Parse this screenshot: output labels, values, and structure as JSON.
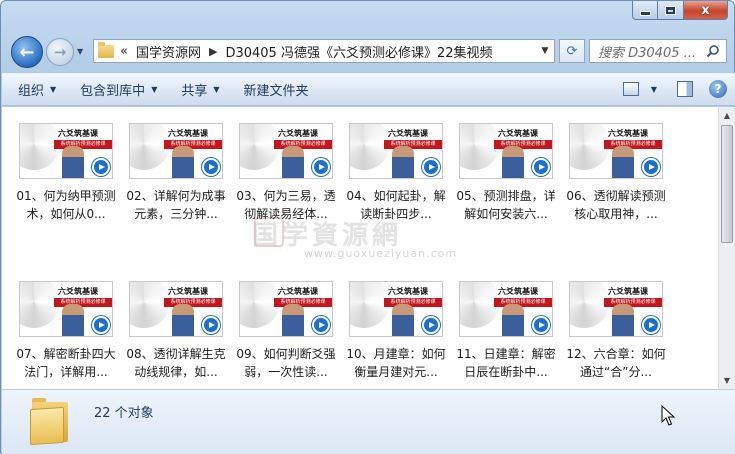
{
  "window": {
    "address_crumbs": [
      "«",
      "国学资源网",
      "D30405 冯德强《六爻预测必修课》22集视频"
    ],
    "search_placeholder": "搜索 D30405 ...",
    "caption_close": "x"
  },
  "toolbar": {
    "items": [
      {
        "label": "组织",
        "has_dropdown": true
      },
      {
        "label": "包含到库中",
        "has_dropdown": true
      },
      {
        "label": "共享",
        "has_dropdown": true
      },
      {
        "label": "新建文件夹",
        "has_dropdown": false
      }
    ]
  },
  "thumbnail": {
    "brand": "六爻筑基课",
    "red_banner": "系统解析预测必修课"
  },
  "files": [
    {
      "label": "01、何为纳甲预测术，如何从0..."
    },
    {
      "label": "02、详解何为成事元素，三分钟..."
    },
    {
      "label": "03、何为三易，透彻解读易经体..."
    },
    {
      "label": "04、如何起卦，解读断卦四步..."
    },
    {
      "label": "05、预测排盘，详解如何安装六..."
    },
    {
      "label": "06、透彻解读预测核心取用神，..."
    },
    {
      "label": "07、解密断卦四大法门，详解用..."
    },
    {
      "label": "08、透彻详解生克动线规律，如..."
    },
    {
      "label": "09、如何判断爻强弱，一次性读..."
    },
    {
      "label": "10、月建章：如何衡量月建对元..."
    },
    {
      "label": "11、日建章：解密日辰在断卦中..."
    },
    {
      "label": "12、六合章：如何通过“合”分..."
    }
  ],
  "watermark": {
    "text": "国学資源網",
    "url": "www.guoxueziyuan.com"
  },
  "status": {
    "object_count": "22 个对象"
  },
  "colors": {
    "accent": "#1b6fd0",
    "banner_red": "#c4161c"
  }
}
